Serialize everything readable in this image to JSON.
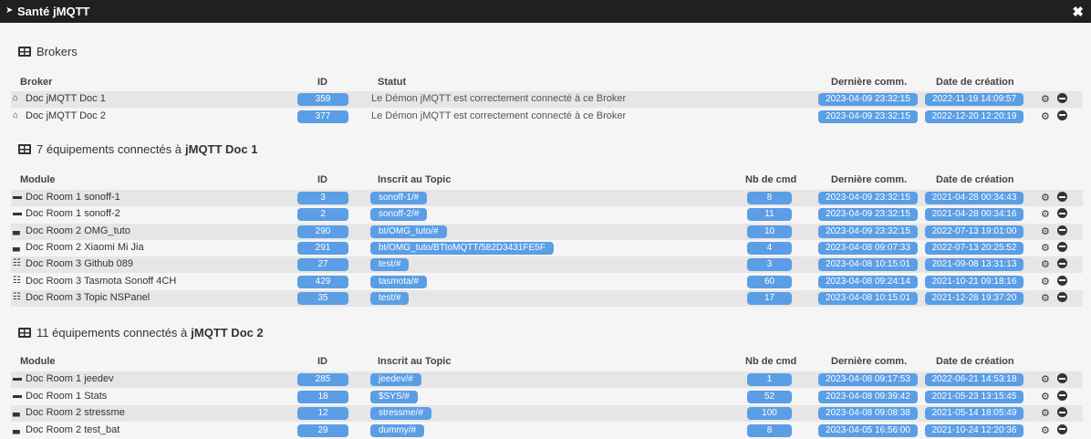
{
  "window": {
    "title": "Santé jMQTT",
    "chevron_icon": "chevron-right-icon",
    "close_icon": "close-icon"
  },
  "brokers": {
    "title": "Brokers",
    "headers": {
      "name": "Broker",
      "id": "ID",
      "statut": "Statut",
      "last": "Dernière comm.",
      "created": "Date de création"
    },
    "rows": [
      {
        "icon": "home-icon",
        "name": "Doc jMQTT Doc 1",
        "id": "359",
        "statut": "Le Démon jMQTT est correctement connecté à ce Broker",
        "last": "2023-04-09 23:32:15",
        "created": "2022-11-19 14:09:57"
      },
      {
        "icon": "home-icon",
        "name": "Doc jMQTT Doc 2",
        "id": "377",
        "statut": "Le Démon jMQTT est correctement connecté à ce Broker",
        "last": "2023-04-09 23:32:15",
        "created": "2022-12-20 12:20:19"
      }
    ]
  },
  "doc1": {
    "title_prefix": "7 équipements connectés à",
    "title_broker": "jMQTT Doc 1",
    "headers": {
      "name": "Module",
      "id": "ID",
      "topic": "Inscrit au Topic",
      "cmd": "Nb de cmd",
      "last": "Dernière comm.",
      "created": "Date de création"
    },
    "rows": [
      {
        "icon": "sofa-icon",
        "name": "Doc Room 1 sonoff-1",
        "id": "3",
        "topic": "sonoff-1/#",
        "cmd": "8",
        "last": "2023-04-09 23:32:15",
        "created": "2021-04-28 00:34:43"
      },
      {
        "icon": "sofa-icon",
        "name": "Doc Room 1 sonoff-2",
        "id": "2",
        "topic": "sonoff-2/#",
        "cmd": "11",
        "last": "2023-04-09 23:32:15",
        "created": "2021-04-28 00:34:16"
      },
      {
        "icon": "bed-icon",
        "name": "Doc Room 2 OMG_tuto",
        "id": "290",
        "topic": "bt/OMG_tuto/#",
        "cmd": "10",
        "last": "2023-04-09 23:32:15",
        "created": "2022-07-13 19:01:00"
      },
      {
        "icon": "bed-icon",
        "name": "Doc Room 2 Xiaomi Mi Jia",
        "id": "291",
        "topic": "bt/OMG_tuto/BTtoMQTT/582D3431FE5F",
        "cmd": "4",
        "last": "2023-04-08 09:07:33",
        "created": "2022-07-13 20:25:52"
      },
      {
        "icon": "desk-icon",
        "name": "Doc Room 3 Github 089",
        "id": "27",
        "topic": "test/#",
        "cmd": "3",
        "last": "2023-04-08 10:15:01",
        "created": "2021-09-08 13:31:13"
      },
      {
        "icon": "desk-icon",
        "name": "Doc Room 3 Tasmota Sonoff 4CH",
        "id": "429",
        "topic": "tasmota/#",
        "cmd": "60",
        "last": "2023-04-08 09:24:14",
        "created": "2021-10-21 09:18:16"
      },
      {
        "icon": "desk-icon",
        "name": "Doc Room 3 Topic NSPanel",
        "id": "35",
        "topic": "test/#",
        "cmd": "17",
        "last": "2023-04-08 10:15:01",
        "created": "2021-12-28 19:37:20"
      }
    ]
  },
  "doc2": {
    "title_prefix": "11 équipements connectés à",
    "title_broker": "jMQTT Doc 2",
    "headers": {
      "name": "Module",
      "id": "ID",
      "topic": "Inscrit au Topic",
      "cmd": "Nb de cmd",
      "last": "Dernière comm.",
      "created": "Date de création"
    },
    "rows": [
      {
        "icon": "sofa-icon",
        "name": "Doc Room 1 jeedev",
        "id": "285",
        "topic": "jeedev/#",
        "cmd": "1",
        "last": "2023-04-08 09:17:53",
        "created": "2022-06-21 14:53:18"
      },
      {
        "icon": "sofa-icon",
        "name": "Doc Room 1 Stats",
        "id": "18",
        "topic": "$SYS/#",
        "cmd": "52",
        "last": "2023-04-08 09:39:42",
        "created": "2021-05-23 13:15:45"
      },
      {
        "icon": "bed-icon",
        "name": "Doc Room 2 stressme",
        "id": "12",
        "topic": "stressme/#",
        "cmd": "100",
        "last": "2023-04-08 09:08:38",
        "created": "2021-05-14 18:05:49"
      },
      {
        "icon": "bed-icon",
        "name": "Doc Room 2 test_bat",
        "id": "29",
        "topic": "dummy/#",
        "cmd": "8",
        "last": "2023-04-05 16:56:00",
        "created": "2021-10-24 12:20:36"
      }
    ]
  },
  "actions": {
    "config_icon": "gears-icon",
    "remove_icon": "minus-circle-icon"
  },
  "colors": {
    "badge": "#5b9ee5",
    "titlebar": "#202020"
  }
}
